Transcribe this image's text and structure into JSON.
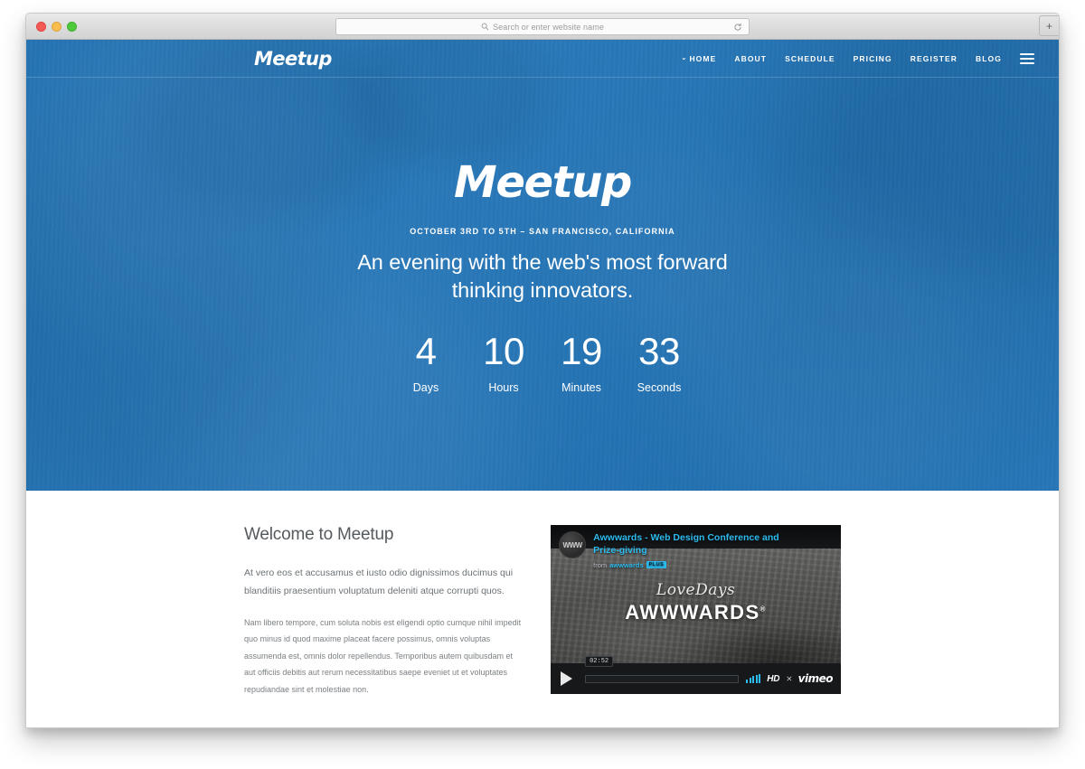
{
  "browser": {
    "address_placeholder": "Search or enter website name",
    "search_icon": "search-icon",
    "reload_icon": "reload-icon",
    "newtab_label": "+"
  },
  "site": {
    "logo": "Meetup",
    "nav": [
      {
        "label": "HOME",
        "caret": "⌄",
        "active": true
      },
      {
        "label": "ABOUT"
      },
      {
        "label": "SCHEDULE"
      },
      {
        "label": "PRICING"
      },
      {
        "label": "REGISTER"
      },
      {
        "label": "BLOG"
      }
    ],
    "menu_icon": "hamburger-menu-icon"
  },
  "hero": {
    "title": "Meetup",
    "date": "OCTOBER 3RD TO 5TH – SAN FRANCISCO, CALIFORNIA",
    "tagline": "An evening with the web's most forward thinking innovators.",
    "countdown": [
      {
        "value": "4",
        "label": "Days"
      },
      {
        "value": "10",
        "label": "Hours"
      },
      {
        "value": "19",
        "label": "Minutes"
      },
      {
        "value": "33",
        "label": "Seconds"
      }
    ]
  },
  "welcome": {
    "title": "Welcome to Meetup",
    "lead": "At vero eos et accusamus et iusto odio dignissimos ducimus qui blanditiis praesentium voluptatum deleniti atque corrupti quos.",
    "body": "Nam libero tempore, cum soluta nobis est eligendi optio cumque nihil impedit quo minus id quod maxime placeat facere possimus, omnis voluptas assumenda est, omnis dolor repellendus. Temporibus autem quibusdam et aut officiis debitis aut rerum necessitatibus saepe eveniet ut et voluptates repudiandae sint et molestiae non."
  },
  "video": {
    "avatar_text": "WWW",
    "title": "Awwwards - Web Design Conference and Prize-giving",
    "from_label": "from",
    "uploader": "awwwards",
    "badge": "PLUS",
    "poster_script": "LoveDays",
    "poster_brand": "AWWWARDS",
    "poster_brand_sup": "®",
    "time": "02:52",
    "hd_label": "HD",
    "fullscreen_icon": "fullscreen-icon",
    "provider": "vimeo",
    "play_icon": "play-icon",
    "volume_icon": "volume-icon"
  },
  "colors": {
    "brand_blue": "#2f79bd",
    "vimeo_blue": "#2dbcf0",
    "text_gray": "#6c7276"
  }
}
